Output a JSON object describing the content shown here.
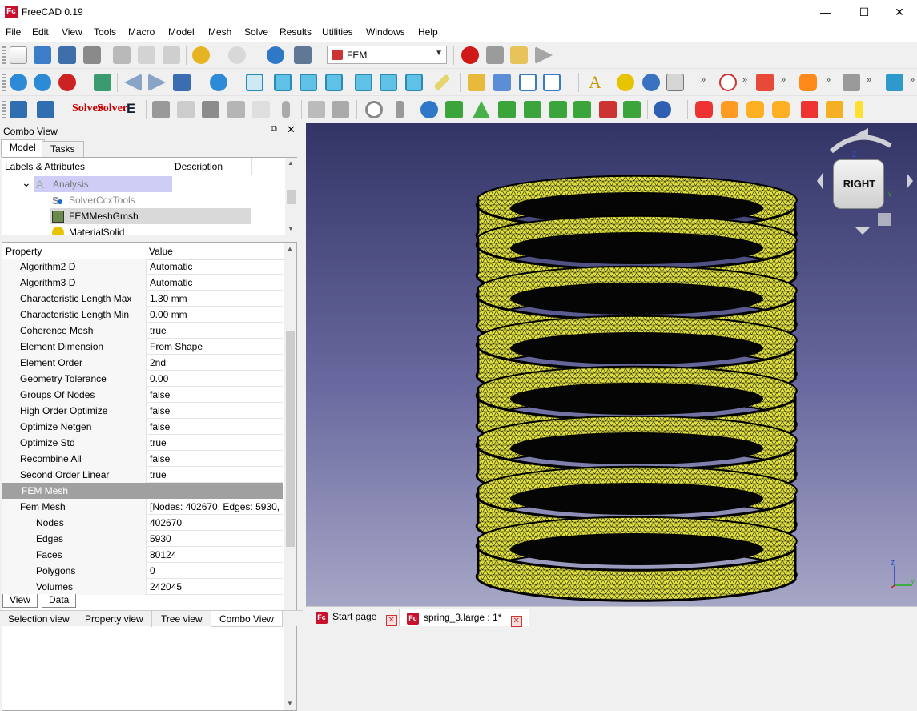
{
  "window": {
    "title": "FreeCAD 0.19",
    "app_icon": "Fc",
    "minimize": "—",
    "maximize": "☐",
    "close": "✕"
  },
  "menu": [
    "File",
    "Edit",
    "View",
    "Tools",
    "Macro",
    "Model",
    "Mesh",
    "Solve",
    "Results",
    "Utilities",
    "Windows",
    "Help"
  ],
  "toolbar": {
    "workbench": "FEM",
    "overflow": "»",
    "solver_label_1": "Solver",
    "solver_label_2": "Solver",
    "e_label": "E",
    "annotation_label": "A",
    "icons": [
      "new-document-icon",
      "open-icon",
      "save-icon",
      "save-as-icon",
      "cut-icon",
      "copy-icon",
      "paste-icon",
      "undo-icon",
      "redo-icon",
      "refresh-icon",
      "whats-this-icon",
      "record-macro-icon",
      "stop-macro-icon",
      "edit-macro-icon",
      "run-macro-icon",
      "fit-all-icon",
      "fit-selection-icon",
      "draw-style-icon",
      "bounding-box-icon",
      "back-icon",
      "forward-icon",
      "sync-view-icon",
      "zoom-icon",
      "isometric-view-icon",
      "front-view-icon",
      "top-view-icon",
      "right-view-icon",
      "rear-view-icon",
      "bottom-view-icon",
      "left-view-icon",
      "measure-icon",
      "part-icon",
      "group-icon",
      "link-icon",
      "link-actions-icon",
      "annotation-icon",
      "sphere-icon",
      "water-drop-icon",
      "shape-icon",
      "axis-icon",
      "fem-analysis-icon",
      "material-icon",
      "clip-icon",
      "solver-icon",
      "equation-icon",
      "mesh-icon",
      "results-icon",
      "constraint-icons"
    ]
  },
  "combo": {
    "title": "Combo View",
    "float_icon": "⧉",
    "close_icon": "✕",
    "tabs": [
      "Model",
      "Tasks"
    ],
    "tree_headers": [
      "Labels & Attributes",
      "Description"
    ],
    "tree": [
      {
        "label": "Analysis",
        "expander": "⌄"
      },
      {
        "label": "SolverCcxTools"
      },
      {
        "label": "FEMMeshGmsh"
      },
      {
        "label": "MaterialSolid"
      }
    ],
    "prop_headers": [
      "Property",
      "Value"
    ],
    "properties": [
      {
        "name": "Algorithm2 D",
        "value": "Automatic"
      },
      {
        "name": "Algorithm3 D",
        "value": "Automatic"
      },
      {
        "name": "Characteristic Length Max",
        "value": "1.30 mm"
      },
      {
        "name": "Characteristic Length Min",
        "value": "0.00 mm"
      },
      {
        "name": "Coherence Mesh",
        "value": "true"
      },
      {
        "name": "Element Dimension",
        "value": "From Shape"
      },
      {
        "name": "Element Order",
        "value": "2nd"
      },
      {
        "name": "Geometry Tolerance",
        "value": "0.00"
      },
      {
        "name": "Groups Of Nodes",
        "value": "false"
      },
      {
        "name": "High Order Optimize",
        "value": "false"
      },
      {
        "name": "Optimize Netgen",
        "value": "false"
      },
      {
        "name": "Optimize Std",
        "value": "true"
      },
      {
        "name": "Recombine All",
        "value": "false"
      },
      {
        "name": "Second Order Linear",
        "value": "true"
      }
    ],
    "group_label": "FEM Mesh",
    "fem_mesh": {
      "name": "Fem Mesh",
      "value": "[Nodes: 402670, Edges: 5930, ...",
      "expander": "⌄"
    },
    "fem_mesh_children": [
      {
        "name": "Nodes",
        "value": "402670"
      },
      {
        "name": "Edges",
        "value": "5930"
      },
      {
        "name": "Faces",
        "value": "80124"
      },
      {
        "name": "Polygons",
        "value": "0"
      },
      {
        "name": "Volumes",
        "value": "242045"
      }
    ],
    "view_tabs": [
      "View",
      "Data"
    ],
    "bottom_tabs": [
      "Selection view",
      "Property view",
      "Tree view",
      "Combo View"
    ]
  },
  "navcube": {
    "face_label": "RIGHT",
    "axis_x": "X",
    "axis_y": "Y",
    "axis_z": "Z"
  },
  "doc_tabs": [
    {
      "label": "Start page",
      "close": "✕"
    },
    {
      "label": "spring_3.large : 1*",
      "close": "✕"
    }
  ],
  "colors": {
    "mesh_fill": "#e6e63c",
    "mesh_edge": "#000000",
    "accent_red": "#c8102e"
  }
}
